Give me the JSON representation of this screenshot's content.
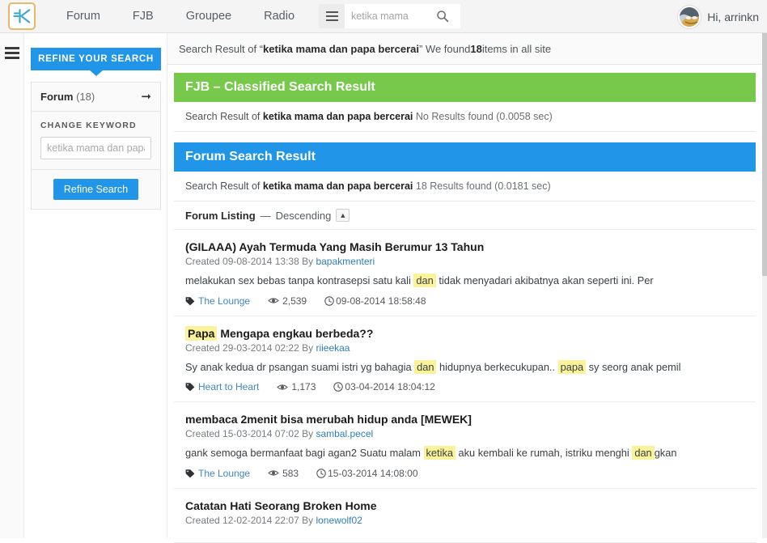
{
  "header": {
    "logo_icon": "kaskus-k-logo",
    "nav": [
      {
        "label": "Forum"
      },
      {
        "label": "FJB"
      },
      {
        "label": "Groupee"
      },
      {
        "label": "Radio"
      }
    ],
    "menu_icon": "hamburger-icon",
    "search": {
      "value": "ketika mama",
      "placeholder": "ketika mama",
      "icon": "search-icon"
    },
    "user": {
      "greeting": "Hi, arrinkn",
      "avatar_icon": "user-avatar"
    }
  },
  "rail": {
    "icon": "hamburger-icon"
  },
  "sidebar": {
    "refine_tab": "REFINE YOUR SEARCH",
    "forum_row": {
      "label": "Forum",
      "count": "(18)",
      "arrow_icon": "arrow-right-icon"
    },
    "change_keyword_label": "CHANGE KEYWORD",
    "keyword_input": {
      "value": "",
      "placeholder": "ketika mama dan papa bercerai"
    },
    "refine_button": "Refine Search"
  },
  "topbar": {
    "prefix": "Search Result of “",
    "query": "ketika mama dan papa bercerai",
    "suffix": "” We found ",
    "count": "18",
    "tail": " items in all site"
  },
  "fjb_section": {
    "heading": "FJB – Classified Search Result",
    "sub_prefix": "Search Result of ",
    "sub_query": "ketika mama dan papa bercerai",
    "sub_result": "No Results found (0.0058 sec)"
  },
  "forum_section": {
    "heading": "Forum Search Result",
    "sub_prefix": "Search Result of ",
    "sub_query": "ketika mama dan papa bercerai",
    "sub_result": "18 Results found (0.0181 sec)",
    "listing_label": "Forum Listing",
    "listing_dash": "—",
    "listing_order": "Descending",
    "sort_icon": "caret-up-icon"
  },
  "results": [
    {
      "title_plain": "(GILAAA) Ayah Termuda Yang Masih Berumur 13 Tahun",
      "title_highlight": "",
      "created_prefix": "Created 09-08-2014 13:38 By ",
      "author": "bapakmenteri",
      "snippet_pre": "melakukan sex bebas tanpa kontrasepsi satu kali ",
      "snippet_hl1": "dan",
      "snippet_mid": " tidak menyadari akibatnya akan seperti ini. Per",
      "snippet_hl2": "",
      "snippet_post": "",
      "category": "The Lounge",
      "views": "2,539",
      "time": "09-08-2014 18:58:48",
      "tag_icon": "tag-icon",
      "views_icon": "eye-icon",
      "time_icon": "clock-icon"
    },
    {
      "title_plain": " Mengapa engkau berbeda??",
      "title_highlight": "Papa",
      "created_prefix": "Created 29-03-2014 02:22 By ",
      "author": "riieekaa",
      "snippet_pre": "Sy anak kedua dr psangan suami istri yg bahagia ",
      "snippet_hl1": "dan",
      "snippet_mid": " hidupnya berkecukupan.. ",
      "snippet_hl2": "papa",
      "snippet_post": " sy seorg anak pemil",
      "category": "Heart to Heart",
      "views": "1,173",
      "time": "03-04-2014 18:04:12",
      "tag_icon": "tag-icon",
      "views_icon": "eye-icon",
      "time_icon": "clock-icon"
    },
    {
      "title_plain": "membaca 2menit bisa merubah hidup anda [MEWEK]",
      "title_highlight": "",
      "created_prefix": "Created 15-03-2014 07:02 By ",
      "author": "sambal.pecel",
      "snippet_pre": "gank semoga bermanfaat bagi agan2 Suatu malam ",
      "snippet_hl1": "ketika",
      "snippet_mid": " aku kembali ke rumah, istriku menghi ",
      "snippet_hl2": "dan",
      "snippet_post": "gkan",
      "category": "The Lounge",
      "views": "583",
      "time": "15-03-2014 14:08:00",
      "tag_icon": "tag-icon",
      "views_icon": "eye-icon",
      "time_icon": "clock-icon"
    },
    {
      "title_plain": "Catatan Hati Seorang Broken Home",
      "title_highlight": "",
      "created_prefix": "Created 12-02-2014 22:07 By ",
      "author": "lonewolf02",
      "snippet_pre": "",
      "snippet_hl1": "",
      "snippet_mid": "",
      "snippet_hl2": "",
      "snippet_post": "",
      "category": "",
      "views": "",
      "time": "",
      "tag_icon": "tag-icon",
      "views_icon": "eye-icon",
      "time_icon": "clock-icon"
    }
  ],
  "colors": {
    "accent_blue": "#2196e8",
    "accent_green": "#76c94b",
    "highlight": "#fbf39a",
    "link": "#3f86bd",
    "logo_border": "#e8b866"
  }
}
